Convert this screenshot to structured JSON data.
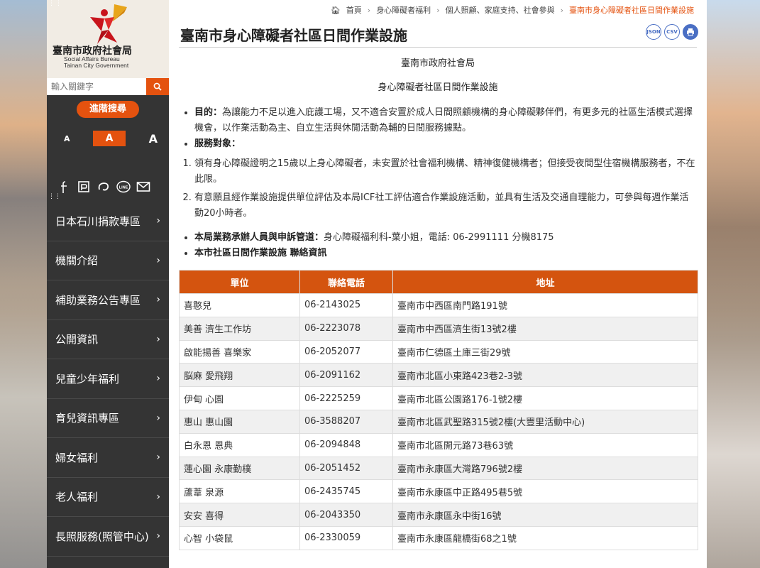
{
  "org": {
    "name_zh": "臺南市政府社會局",
    "name_en_1": "Social Affairs Bureau",
    "name_en_2": "Tainan City Government"
  },
  "search": {
    "placeholder": "輸入關鍵字",
    "advanced_label": "進階搜尋"
  },
  "font_size": {
    "small": "A",
    "medium": "A",
    "large": "A"
  },
  "nav": [
    "日本石川捐款專區",
    "機關介紹",
    "補助業務公告專區",
    "公開資訊",
    "兒童少年福利",
    "育兒資訊專區",
    "婦女福利",
    "老人福利",
    "長照服務(照管中心)"
  ],
  "breadcrumb": [
    {
      "label": "首頁"
    },
    {
      "label": "身心障礙者福利"
    },
    {
      "label": "個人照顧、家庭支持、社會參與"
    },
    {
      "label": "臺南市身心障礙者社區日間作業設施"
    }
  ],
  "page": {
    "title": "臺南市身心障礙者社區日間作業設施",
    "export_json": "JSON",
    "export_csv": "CSV"
  },
  "article": {
    "org_heading": "臺南市政府社會局",
    "heading": "身心障礙者社區日間作業設施",
    "purpose_label": "目的：",
    "purpose_text": "為讓能力不足以進入庇護工場，又不適合安置於成人日間照顧機構的身心障礙夥伴們，有更多元的社區生活模式選擇機會，以作業活動為主、自立生活與休閒活動為輔的日間服務據點。",
    "target_label": "服務對象：",
    "criteria": [
      "領有身心障礙證明之15歲以上身心障礙者，未安置於社會福利機構、精神復健機構者；但接受夜間型住宿機構服務者，不在此限。",
      "有意願且經作業設施提供單位評估及本局ICF社工評估適合作業設施活動，並具有生活及交通自理能力，可參與每週作業活動20小時者。"
    ],
    "contact_label": "本局業務承辦人員與申訴管道：",
    "contact_text": "身心障礙福利科-葉小姐，電話: 06-2991111 分機8175",
    "list_label": "本市社區日間作業設施 聯絡資訊"
  },
  "table": {
    "headers": [
      "單位",
      "聯絡電話",
      "地址"
    ],
    "rows": [
      [
        "喜憨兒",
        "06-2143025",
        "臺南市中西區南門路191號"
      ],
      [
        "美善 濟生工作坊",
        "06-2223078",
        "臺南市中西區濟生街13號2樓"
      ],
      [
        "啟能揚善 喜樂家",
        "06-2052077",
        "臺南市仁德區土庫三街29號"
      ],
      [
        "脳麻 愛飛翔",
        "06-2091162",
        "臺南市北區小東路423巷2-3號"
      ],
      [
        "伊甸 心園",
        "06-2225259",
        "臺南市北區公園路176-1號2樓"
      ],
      [
        "惠山 惠山園",
        "06-3588207",
        "臺南市北區武聖路315號2樓(大豐里活動中心)"
      ],
      [
        "白永恩 恩典",
        "06-2094848",
        "臺南市北區開元路73巷63號"
      ],
      [
        "蓮心園 永康勤樸",
        "06-2051452",
        "臺南市永康區大灣路796號2樓"
      ],
      [
        "蘆葦 泉源",
        "06-2435745",
        "臺南市永康區中正路495巷5號"
      ],
      [
        "安安 喜得",
        "06-2043350",
        "臺南市永康區永中街16號"
      ],
      [
        "心智 小袋鼠",
        "06-2330059",
        "臺南市永康區龍橋街68之1號"
      ]
    ]
  }
}
